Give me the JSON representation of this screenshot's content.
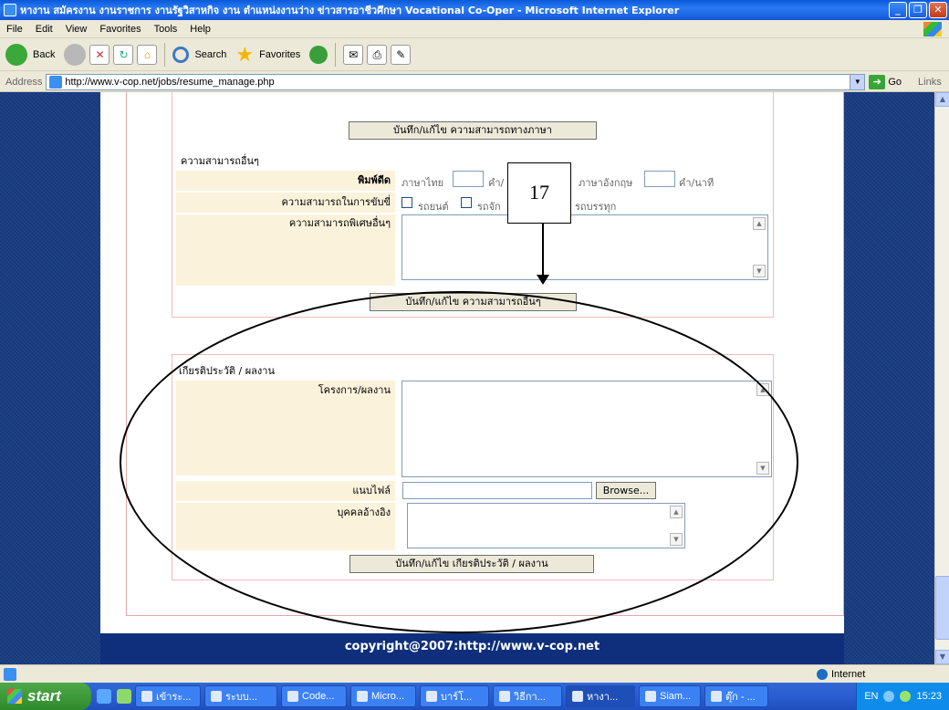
{
  "window": {
    "title": "หางาน สมัครงาน งานราชการ งานรัฐวิสาหกิจ งาน ตำแหน่งงานว่าง ข่าวสารอาชีวศึกษา Vocational Co-Oper - Microsoft Internet Explorer",
    "min": "_",
    "max": "❐",
    "close": "✕"
  },
  "menu": [
    "File",
    "Edit",
    "View",
    "Favorites",
    "Tools",
    "Help"
  ],
  "toolbar": {
    "back": "Back",
    "search": "Search",
    "favorites": "Favorites"
  },
  "address": {
    "label": "Address",
    "url": "http://www.v-cop.net/jobs/resume_manage.php",
    "go": "Go",
    "links": "Links"
  },
  "page": {
    "language_save_button": "บันทึก/แก้ไข ความสามารถทางภาษา",
    "other_skills": {
      "heading": "ความสามารถอื่นๆ",
      "typing_label": "พิมพ์ดีด",
      "thai_label": "ภาษาไทย",
      "thai_unit": "คำ/",
      "english_label": "ภาษาอังกฤษ",
      "english_unit": "คำ/นาที",
      "driving_label": "ความสามารถในการขับขี่",
      "car_label": "รถยนต์",
      "moto_label": "รถจัก",
      "truck_label": "รถบรรทุก",
      "special_label": "ความสามารถพิเศษอื่นๆ",
      "save_button": "บันทึก/แก้ไข ความสามารถอื่นๆ"
    },
    "honors": {
      "heading": "เกียรติประวัติ / ผลงาน",
      "project_label": "โครงการ/ผลงาน",
      "attach_label": "แนบไฟล์",
      "browse_button": "Browse...",
      "reference_label": "บุคคลอ้างอิง",
      "save_button": "บันทึก/แก้ไข  เกียรติประวัติ / ผลงาน"
    },
    "callout_number": "17",
    "footer": "copyright@2007:http://www.v-cop.net"
  },
  "statusbar": {
    "zone": "Internet"
  },
  "taskbar": {
    "start": "start",
    "tasks": [
      "เข้าระ...",
      "ระบบ...",
      "Code...",
      "Micro...",
      "บาร์โ...",
      "วิธีกา...",
      "หางา...",
      "Siam...",
      "ตุ๊ก - ..."
    ],
    "lang": "EN",
    "clock": "15:23"
  }
}
